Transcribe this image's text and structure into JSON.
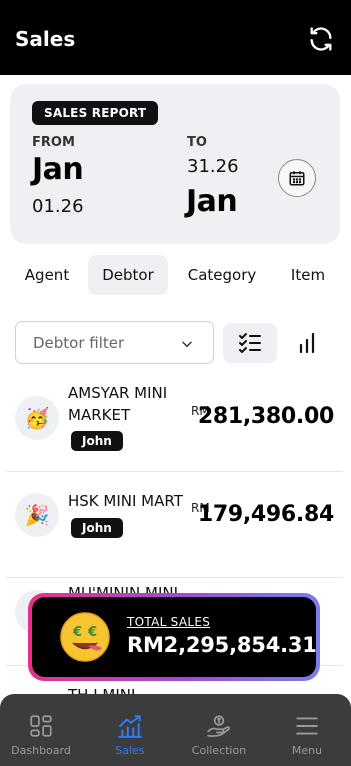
{
  "header": {
    "title": "Sales",
    "refresh_icon": "refresh-icon"
  },
  "report": {
    "badge": "SALES REPORT",
    "from_label": "FROM",
    "from_month": "Jan",
    "from_date": "01.26",
    "to_label": "TO",
    "to_date": "31.26",
    "to_month": "Jan",
    "calendar_icon": "calendar-icon"
  },
  "tabs": [
    {
      "label": "Agent",
      "active": false
    },
    {
      "label": "Debtor",
      "active": true
    },
    {
      "label": "Category",
      "active": false
    },
    {
      "label": "Item",
      "active": false
    }
  ],
  "filter": {
    "placeholder": "Debtor filter",
    "chevron_icon": "chevron-down-icon",
    "list_icon": "checklist-icon",
    "chart_icon": "bar-chart-icon"
  },
  "debtors": [
    {
      "name": "AMSYAR MINI MARKET",
      "agent": "John",
      "currency": "RM",
      "amount": "281,380.00",
      "avatar": "🥳"
    },
    {
      "name": "HSK MINI MART",
      "agent": "John",
      "currency": "RM",
      "amount": "179,496.84",
      "avatar": "🎉"
    },
    {
      "name": "MU'MININ MINI",
      "agent": "",
      "currency": "",
      "amount": "",
      "avatar": ""
    },
    {
      "name": "TH I MINI",
      "agent": "",
      "currency": "",
      "amount": "",
      "avatar": ""
    }
  ],
  "total": {
    "label": "TOTAL SALES",
    "value": "RM2,295,854.31",
    "icon": "money-face-icon"
  },
  "nav": [
    {
      "label": "Dashboard",
      "icon": "dashboard-icon",
      "active": false
    },
    {
      "label": "Sales",
      "icon": "sales-chart-icon",
      "active": true
    },
    {
      "label": "Collection",
      "icon": "collection-icon",
      "active": false
    },
    {
      "label": "Menu",
      "icon": "menu-icon",
      "active": false
    }
  ],
  "colors": {
    "accent": "#2f7cf6",
    "dark": "#000000",
    "nav_bg": "#3c3c3c",
    "gradient": [
      "#e8308a",
      "#a24ad1",
      "#7b7cf0"
    ]
  }
}
